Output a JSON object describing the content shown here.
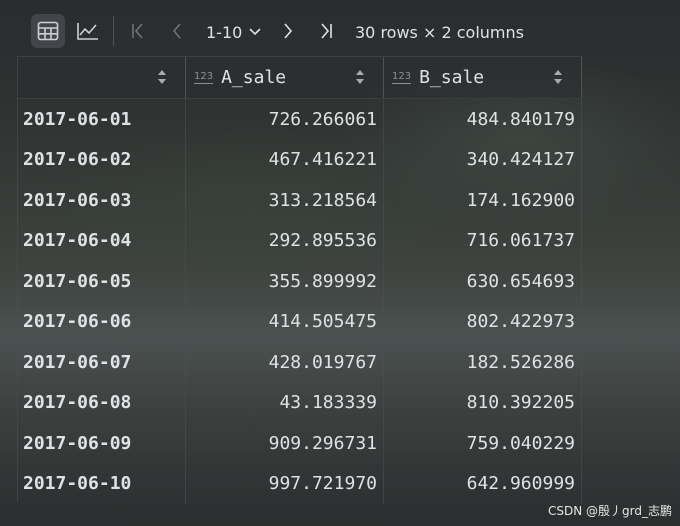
{
  "toolbar": {
    "page_range": "1-10",
    "rows_info": "30 rows × 2 columns"
  },
  "icons": {
    "table_view": "table-icon",
    "chart_view": "line-chart-icon",
    "first_page": "first-page-icon",
    "prev_page": "prev-page-icon",
    "next_page": "next-page-icon",
    "last_page": "last-page-icon"
  },
  "table": {
    "index_header": "",
    "type_badge": "123",
    "columns": [
      "A_sale",
      "B_sale"
    ],
    "rows": [
      {
        "index": "2017-06-01",
        "a": "726.266061",
        "b": "484.840179"
      },
      {
        "index": "2017-06-02",
        "a": "467.416221",
        "b": "340.424127"
      },
      {
        "index": "2017-06-03",
        "a": "313.218564",
        "b": "174.162900"
      },
      {
        "index": "2017-06-04",
        "a": "292.895536",
        "b": "716.061737"
      },
      {
        "index": "2017-06-05",
        "a": "355.899992",
        "b": "630.654693"
      },
      {
        "index": "2017-06-06",
        "a": "414.505475",
        "b": "802.422973"
      },
      {
        "index": "2017-06-07",
        "a": "428.019767",
        "b": "182.526286"
      },
      {
        "index": "2017-06-08",
        "a": "43.183339",
        "b": "810.392205"
      },
      {
        "index": "2017-06-09",
        "a": "909.296731",
        "b": "759.040229"
      },
      {
        "index": "2017-06-10",
        "a": "997.721970",
        "b": "642.960999"
      }
    ]
  },
  "watermark": "CSDN @殷丿grd_志鹏"
}
